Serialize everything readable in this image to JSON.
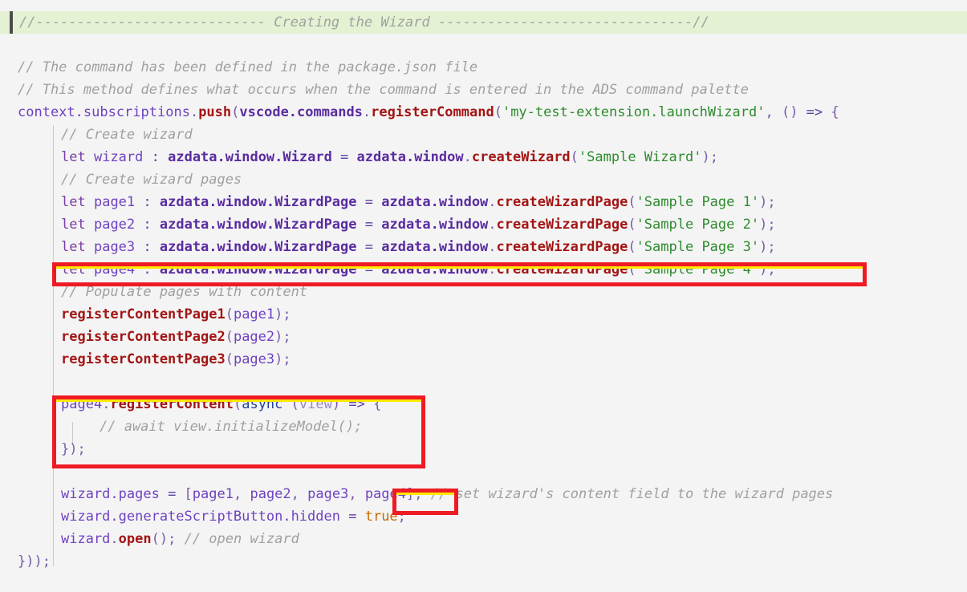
{
  "document": {
    "title": "Creating the Wizard",
    "language": "typescript",
    "background_color": "#f4f4f4",
    "banner_highlight_color": "#e4f2d3",
    "annotation_color": "#ee1b24",
    "annotation_inner_color": "#ffe800"
  },
  "colors": {
    "comment": "#a0a0a0",
    "keyword": "#7a3ea8",
    "identifier": "#6f42c1",
    "bold_identifier": "#5a2ca0",
    "function": "#a31515",
    "string": "#2e8b2e",
    "punctuation": "#7a5ba8",
    "operator": "#5a3fa0",
    "boolean": "#c66a00",
    "async_keyword": "#24419b",
    "parameter": "#9d84c9"
  },
  "code": {
    "banner": {
      "text": "//---------------------------- Creating the Wizard -------------------------------//"
    },
    "lines": {
      "comment_command_defined": "// The command has been defined in the package.json file",
      "comment_method_defines": "// This method defines what occurs when the command is entered in the ADS command palette",
      "register_command": {
        "context": "context.subscriptions",
        "dot1": ".",
        "push": "push",
        "open_paren": "(",
        "vscode_commands": "vscode.commands",
        "dot2": ".",
        "register_command": "registerCommand",
        "open_paren2": "(",
        "command_id": "'my-test-extension.launchWizard'",
        "comma": ", ",
        "arrow_params": "()",
        "arrow": " => ",
        "open_brace": "{"
      },
      "comment_create_wizard": "// Create wizard",
      "let_wizard": {
        "let": "let",
        "name": "wizard",
        "colon": " : ",
        "type": "azdata.window.Wizard",
        "equals": " = ",
        "ns": "azdata.window",
        "dot": ".",
        "fn": "createWizard",
        "open_paren": "(",
        "arg": "'Sample Wizard'",
        "close": ");"
      },
      "comment_create_wizard_pages": "// Create wizard pages",
      "let_page1": {
        "let": "let",
        "name": "page1",
        "colon": " : ",
        "type": "azdata.window.WizardPage",
        "equals": " = ",
        "ns": "azdata.window",
        "dot": ".",
        "fn": "createWizardPage",
        "open_paren": "(",
        "arg": "'Sample Page 1'",
        "close": ");"
      },
      "let_page2": {
        "let": "let",
        "name": "page2",
        "colon": " : ",
        "type": "azdata.window.WizardPage",
        "equals": " = ",
        "ns": "azdata.window",
        "dot": ".",
        "fn": "createWizardPage",
        "open_paren": "(",
        "arg": "'Sample Page 2'",
        "close": ");"
      },
      "let_page3": {
        "let": "let",
        "name": "page3",
        "colon": " : ",
        "type": "azdata.window.WizardPage",
        "equals": " = ",
        "ns": "azdata.window",
        "dot": ".",
        "fn": "createWizardPage",
        "open_paren": "(",
        "arg": "'Sample Page 3'",
        "close": ");"
      },
      "let_page4": {
        "let": "let",
        "name": "page4",
        "colon": " : ",
        "type": "azdata.window.WizardPage",
        "equals": " = ",
        "ns": "azdata.window",
        "dot": ".",
        "fn": "createWizardPage",
        "open_paren": "(",
        "arg": "'Sample Page 4'",
        "close": ");"
      },
      "comment_populate_pages": "// Populate pages with content",
      "register_content_page1": {
        "fn": "registerContentPage1",
        "open_paren": "(",
        "arg": "page1",
        "close": ");"
      },
      "register_content_page2": {
        "fn": "registerContentPage2",
        "open_paren": "(",
        "arg": "page2",
        "close": ");"
      },
      "register_content_page3": {
        "fn": "registerContentPage3",
        "open_paren": "(",
        "arg": "page3",
        "close": ");"
      },
      "page4_register_content": {
        "obj": "page4",
        "dot": ".",
        "fn": "registerContent",
        "open_paren": "(",
        "async": "async",
        "space": " ",
        "params_open": "(",
        "param": "view",
        "params_close": ")",
        "arrow": " => ",
        "open_brace": "{"
      },
      "comment_await_initialize": "// await view.initializeModel();",
      "close_register_content": "});",
      "wizard_pages": {
        "obj": "wizard.pages",
        "equals": " = ",
        "bracket_open": "[",
        "page1": "page1",
        "sep1": ", ",
        "page2": "page2",
        "sep2": ", ",
        "page3": "page3",
        "sep3": ", ",
        "page4": "page4",
        "bracket_close": "]",
        "semi": ";",
        "comment": "// set wizard's content field to the wizard pages"
      },
      "generate_script_button": {
        "obj": "wizard.generateScriptButton.hidden",
        "equals": " = ",
        "value": "true",
        "semi": ";"
      },
      "wizard_open": {
        "obj": "wizard",
        "dot": ".",
        "fn": "open",
        "call": "();",
        "comment": "// open wizard"
      },
      "close_all": "}));"
    }
  },
  "annotations": [
    {
      "name": "highlight-let-page4",
      "target": "let page4 : azdata.window.WizardPage = azdata.window.createWizardPage('Sample Page 4');"
    },
    {
      "name": "highlight-register-content-block",
      "target": "page4.registerContent(async (view) => { // await view.initializeModel(); });"
    },
    {
      "name": "highlight-page4-in-pages-array",
      "target": "page4]"
    }
  ]
}
